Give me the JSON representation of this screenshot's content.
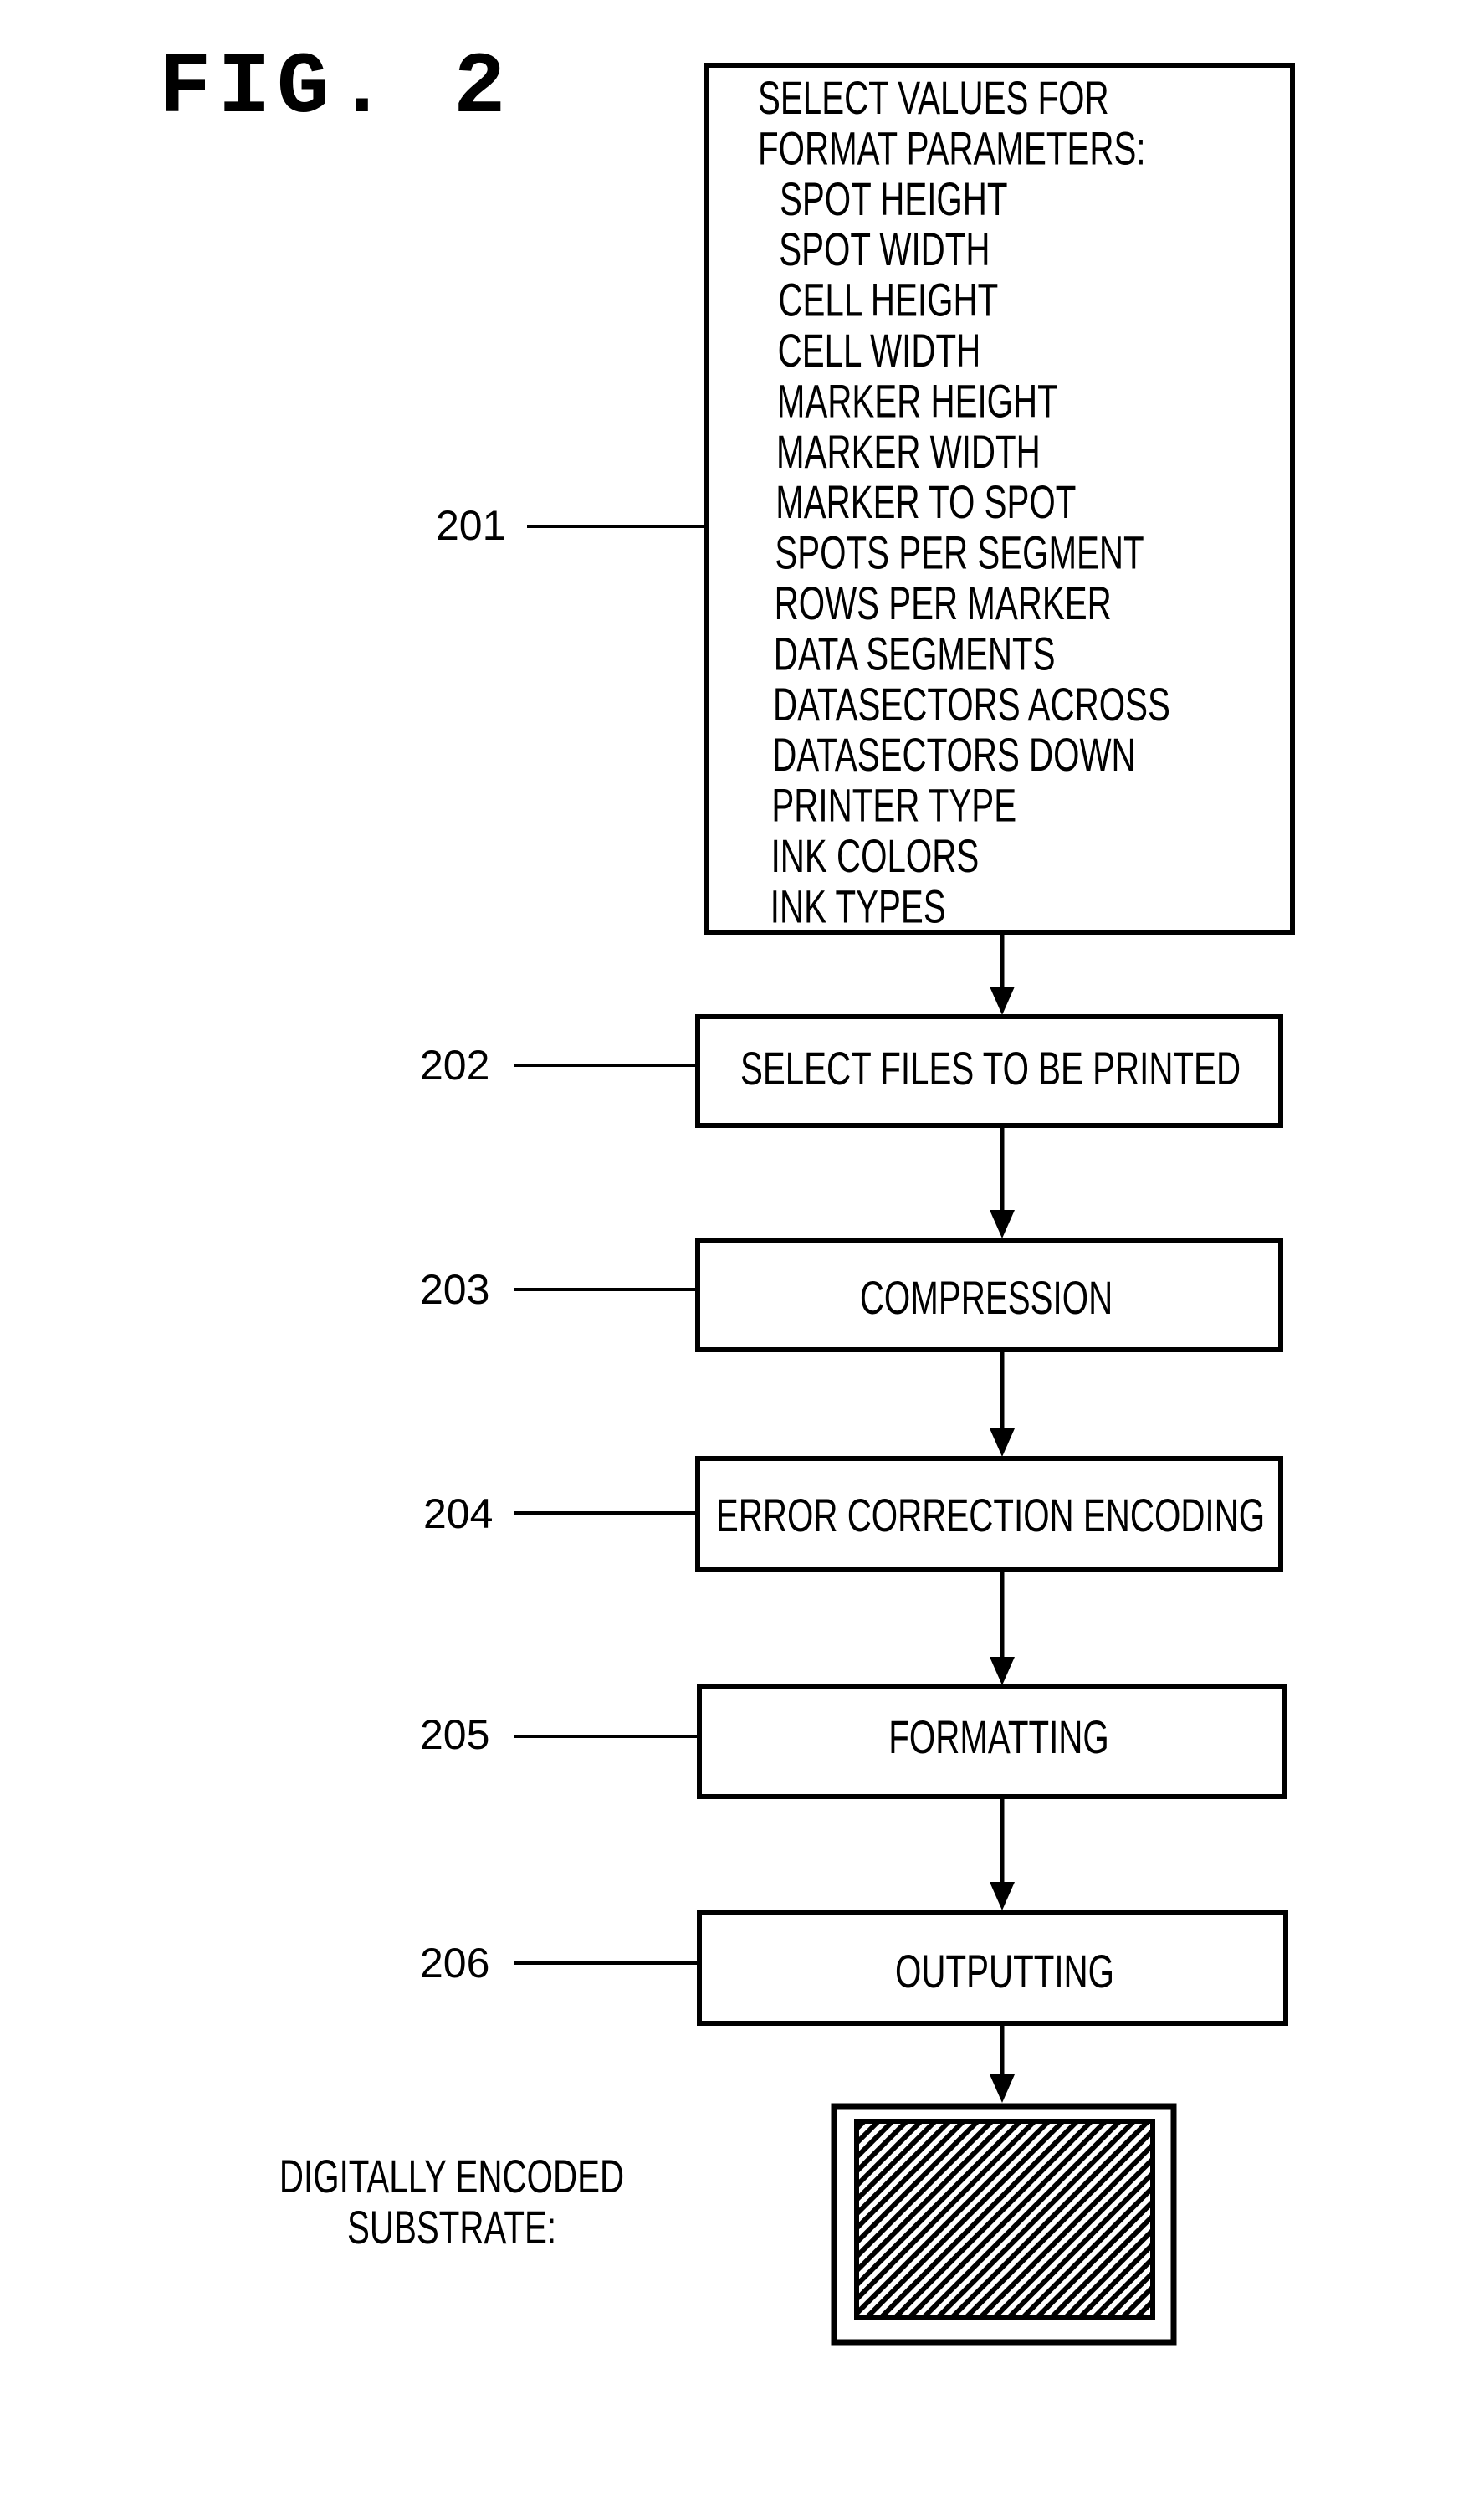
{
  "figure": {
    "title": "FIG. 2"
  },
  "steps": [
    {
      "ref": "201",
      "heading": [
        "SELECT VALUES FOR",
        "FORMAT PARAMETERS:"
      ],
      "items": [
        "SPOT HEIGHT",
        "SPOT WIDTH",
        "CELL HEIGHT",
        "CELL WIDTH",
        "MARKER HEIGHT",
        "MARKER WIDTH",
        "MARKER TO SPOT",
        "SPOTS PER SEGMENT",
        "ROWS PER MARKER",
        "DATA SEGMENTS",
        "DATASECTORS ACROSS",
        "DATASECTORS DOWN",
        "PRINTER TYPE",
        "INK COLORS",
        "INK TYPES"
      ]
    },
    {
      "ref": "202",
      "label": "SELECT FILES TO BE PRINTED"
    },
    {
      "ref": "203",
      "label": "COMPRESSION"
    },
    {
      "ref": "204",
      "label": "ERROR CORRECTION ENCODING"
    },
    {
      "ref": "205",
      "label": "FORMATTING"
    },
    {
      "ref": "206",
      "label": "OUTPUTTING"
    }
  ],
  "output": {
    "caption": [
      "DIGITALLY ENCODED",
      "SUBSTRATE:"
    ],
    "symbol": "hatched-substrate"
  },
  "colors": {
    "ink": "#000000",
    "paper": "#ffffff"
  }
}
